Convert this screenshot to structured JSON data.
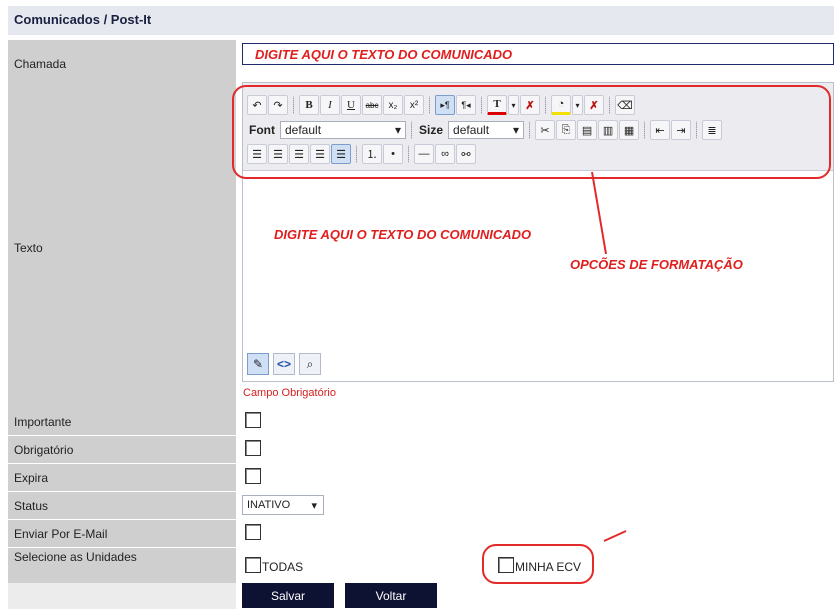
{
  "header": {
    "title": "Comunicados / Post-It"
  },
  "labels": {
    "chamada": "Chamada",
    "texto": "Texto",
    "importante": "Importante",
    "obrigatorio": "Obrigatório",
    "expira": "Expira",
    "status": "Status",
    "enviar_email": "Enviar Por E-Mail",
    "unidades": "Selecione as Unidades"
  },
  "chamada": {
    "value": "DIGITE AQUI O TEXTO DO COMUNICADO"
  },
  "editor": {
    "font_label": "Font",
    "font_value": "default",
    "size_label": "Size",
    "size_value": "default",
    "body_hint": "DIGITE AQUI O TEXTO DO COMUNICADO",
    "formatting_note": "OPCÕES DE FORMATAÇÃO",
    "required_text": "Campo Obrigatório"
  },
  "status": {
    "selected": "INATIVO"
  },
  "units": {
    "all_label": "TODAS",
    "mine_label": "MINHA ECV"
  },
  "buttons": {
    "save": "Salvar",
    "back": "Voltar"
  },
  "colors": {
    "accent": "#e01e1e",
    "dark_button": "#0e1232",
    "label_bg": "#cfcfcf"
  }
}
